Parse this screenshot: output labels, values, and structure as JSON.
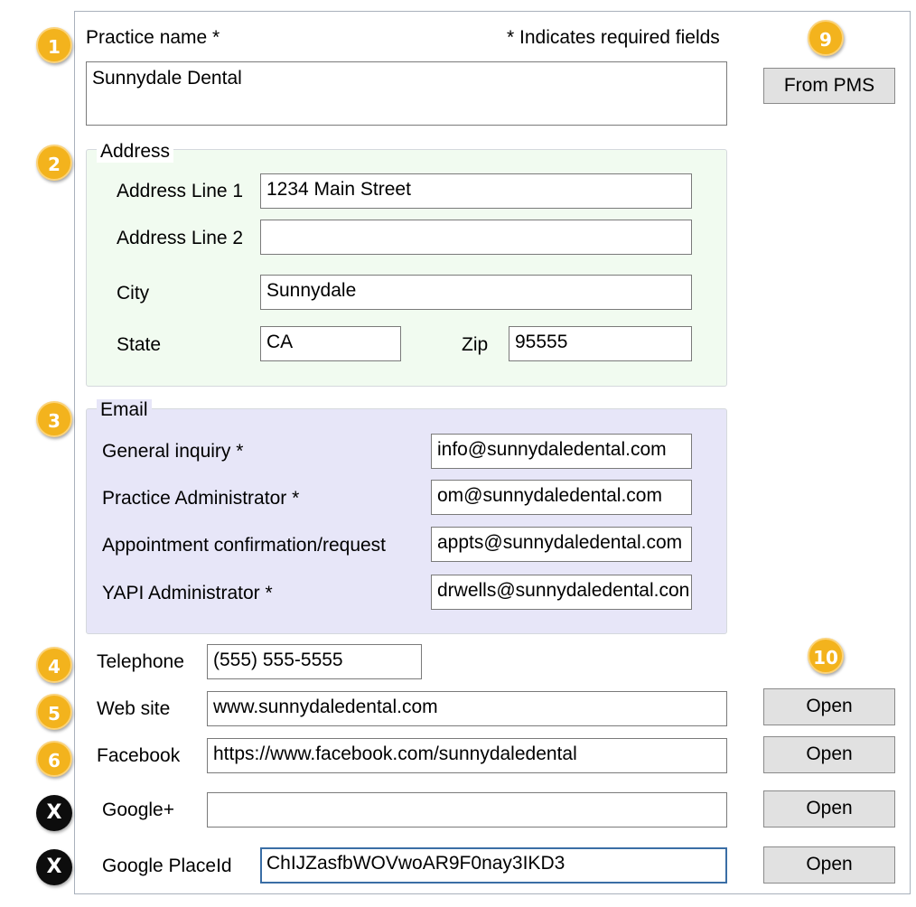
{
  "badges": {
    "b1": "1",
    "b2": "2",
    "b3": "3",
    "b4": "4",
    "b5": "5",
    "b6": "6",
    "b9": "9",
    "b10": "10",
    "bx1": "X",
    "bx2": "X"
  },
  "practice": {
    "label": "Practice name *",
    "required_note": "* Indicates required fields",
    "value": "Sunnydale Dental",
    "from_pms_button": "From PMS"
  },
  "address": {
    "legend": "Address",
    "line1_label": "Address Line 1",
    "line1_value": "1234 Main Street",
    "line2_label": "Address Line 2",
    "line2_value": "",
    "city_label": "City",
    "city_value": "Sunnydale",
    "state_label": "State",
    "state_value": "CA",
    "zip_label": "Zip",
    "zip_value": "95555"
  },
  "email": {
    "legend": "Email",
    "general_label": "General inquiry *",
    "general_value": "info@sunnydaledental.com",
    "admin_label": "Practice Administrator *",
    "admin_value": "om@sunnydaledental.com",
    "appt_label": "Appointment confirmation/request",
    "appt_value": "appts@sunnydaledental.com",
    "yapi_label": "YAPI Administrator *",
    "yapi_value": "drwells@sunnydaledental.con"
  },
  "contact": {
    "telephone_label": "Telephone",
    "telephone_value": "(555) 555-5555",
    "website_label": "Web site",
    "website_value": "www.sunnydaledental.com",
    "facebook_label": "Facebook",
    "facebook_value": "https://www.facebook.com/sunnydaledental",
    "googleplus_label": "Google+",
    "googleplus_value": "",
    "placeid_label": "Google PlaceId",
    "placeid_value": "ChIJZasfbWOVwoAR9F0nay3IKD3",
    "open_button": "Open"
  },
  "colors": {
    "address_bg": "#f1fbf0",
    "email_bg": "#e7e6f8",
    "badge_yellow": "#f3b31d",
    "badge_black": "#0d0d0d",
    "button_bg": "#e1e1e1",
    "focus_border": "#3a6ea5"
  }
}
